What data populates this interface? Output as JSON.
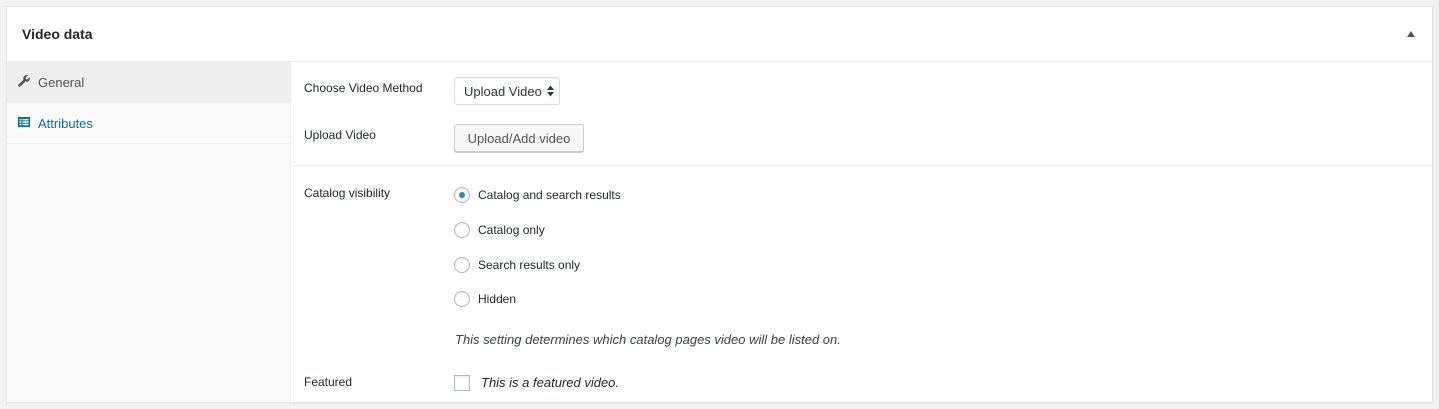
{
  "metabox": {
    "title": "Video data",
    "toggle_icon": "triangle-up-icon"
  },
  "tabs": [
    {
      "label": "General",
      "icon": "wrench-icon",
      "active": true
    },
    {
      "label": "Attributes",
      "icon": "list-view-icon",
      "active": false
    }
  ],
  "colors": {
    "link": "#0073aa",
    "radio_checked": "#1e8cbe",
    "active_tab_bg": "#eeeeee"
  },
  "general": {
    "video_method": {
      "label": "Choose Video Method",
      "selected": "Upload Video"
    },
    "upload": {
      "label": "Upload Video",
      "button_label": "Upload/Add video"
    },
    "catalog_visibility": {
      "label": "Catalog visibility",
      "options": [
        {
          "label": "Catalog and search results",
          "checked": true
        },
        {
          "label": "Catalog only",
          "checked": false
        },
        {
          "label": "Search results only",
          "checked": false
        },
        {
          "label": "Hidden",
          "checked": false
        }
      ],
      "description": "This setting determines which catalog pages video will be listed on."
    },
    "featured": {
      "label": "Featured",
      "checkbox_label": "This is a featured video.",
      "checked": false
    }
  }
}
